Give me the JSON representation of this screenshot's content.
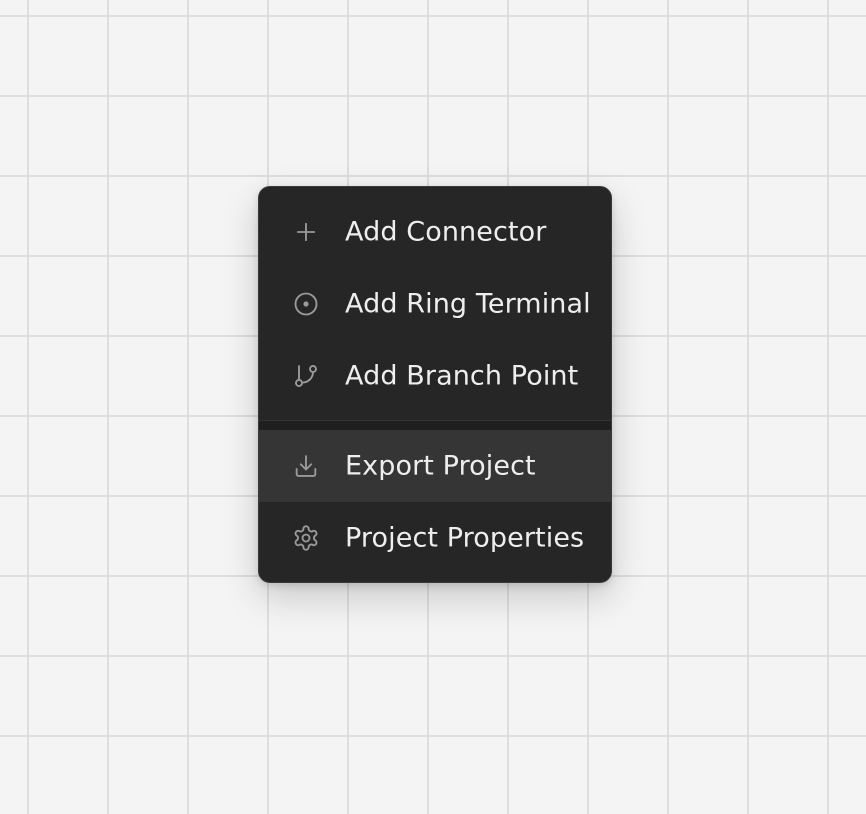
{
  "context_menu": {
    "items": [
      {
        "label": "Add Connector",
        "icon": "plus-icon"
      },
      {
        "label": "Add Ring Terminal",
        "icon": "ring-terminal-icon"
      },
      {
        "label": "Add Branch Point",
        "icon": "git-branch-icon"
      },
      {
        "label": "Export Project",
        "icon": "download-icon",
        "highlighted": true
      },
      {
        "label": "Project Properties",
        "icon": "gear-icon"
      }
    ]
  },
  "colors": {
    "canvas_background": "#f4f4f4",
    "grid_line": "#dedede",
    "menu_background": "#262626",
    "menu_hover": "#353535",
    "menu_text": "#eeeeee",
    "menu_icon": "#9a9a9a"
  }
}
